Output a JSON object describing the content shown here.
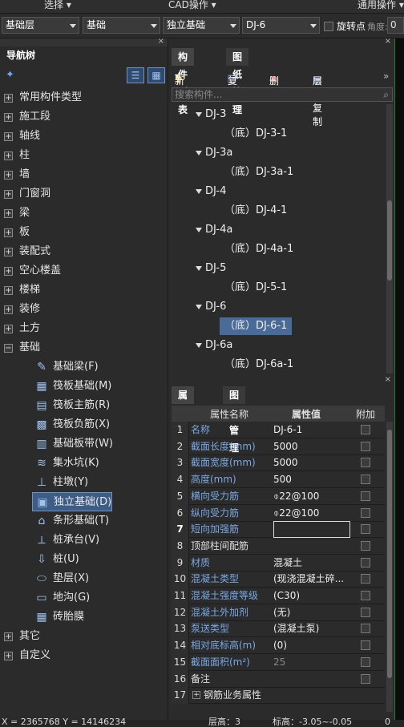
{
  "menu": {
    "select": "选择",
    "cad": "CAD操作",
    "general": "通用操作"
  },
  "toolbar": {
    "floor": "基础层",
    "category": "基础",
    "type": "独立基础",
    "component": "DJ-6",
    "rotate_label": "旋转点",
    "angle_label": "角度:",
    "angle_value": "0"
  },
  "nav": {
    "title": "导航树",
    "items": [
      "常用构件类型",
      "施工段",
      "轴线",
      "柱",
      "墙",
      "门窗洞",
      "梁",
      "板",
      "装配式",
      "空心楼盖",
      "楼梯",
      "装修",
      "土方",
      "基础"
    ],
    "sub_items": [
      "基础梁(F)",
      "筏板基础(M)",
      "筏板主筋(R)",
      "筏板负筋(X)",
      "基础板带(W)",
      "集水坑(K)",
      "柱墩(Y)",
      "独立基础(D)",
      "条形基础(T)",
      "桩承台(V)",
      "桩(U)",
      "垫层(X)",
      "地沟(G)",
      "砖胎膜"
    ],
    "bottom_items": [
      "其它",
      "自定义"
    ]
  },
  "comp_panel": {
    "tab_list": "构件列表",
    "tab_drawings": "图纸管理",
    "new": "新建",
    "copy": "复制",
    "delete": "删除",
    "floor_copy": "层间复制",
    "search_placeholder": "搜索构件...",
    "items": [
      {
        "label": "DJ-3",
        "level": 0
      },
      {
        "label": "（底）DJ-3-1",
        "level": 1
      },
      {
        "label": "DJ-3a",
        "level": 0
      },
      {
        "label": "（底）DJ-3a-1",
        "level": 1
      },
      {
        "label": "DJ-4",
        "level": 0
      },
      {
        "label": "（底）DJ-4-1",
        "level": 1
      },
      {
        "label": "DJ-4a",
        "level": 0
      },
      {
        "label": "（底）DJ-4a-1",
        "level": 1
      },
      {
        "label": "DJ-5",
        "level": 0
      },
      {
        "label": "（底）DJ-5-1",
        "level": 1
      },
      {
        "label": "DJ-6",
        "level": 0
      },
      {
        "label": "（底）DJ-6-1",
        "level": 1,
        "selected": true
      },
      {
        "label": "DJ-6a",
        "level": 0
      },
      {
        "label": "（底）DJ-6a-1",
        "level": 1
      }
    ]
  },
  "prop_panel": {
    "tab_props": "属性列表",
    "tab_layers": "图层管理",
    "col_name": "属性名称",
    "col_value": "属性值",
    "col_attach": "附加",
    "rows": [
      {
        "n": "1",
        "k": "名称",
        "v": "DJ-6-1",
        "blue": true
      },
      {
        "n": "2",
        "k": "截面长度(mm)",
        "v": "5000",
        "blue": true
      },
      {
        "n": "3",
        "k": "截面宽度(mm)",
        "v": "5000",
        "blue": true
      },
      {
        "n": "4",
        "k": "高度(mm)",
        "v": "500",
        "blue": true
      },
      {
        "n": "5",
        "k": "横向受力筋",
        "v": "⌽22@100",
        "blue": true
      },
      {
        "n": "6",
        "k": "纵向受力筋",
        "v": "⌽22@100",
        "blue": true
      },
      {
        "n": "7",
        "k": "短向加强筋",
        "v": "",
        "blue": true,
        "editing": true
      },
      {
        "n": "8",
        "k": "顶部柱间配筋",
        "v": "",
        "blue": false
      },
      {
        "n": "9",
        "k": "材质",
        "v": "混凝土",
        "blue": true
      },
      {
        "n": "10",
        "k": "混凝土类型",
        "v": "(现浇混凝土碎...",
        "blue": true
      },
      {
        "n": "11",
        "k": "混凝土强度等级",
        "v": "(C30)",
        "blue": true
      },
      {
        "n": "12",
        "k": "混凝土外加剂",
        "v": "(无)",
        "blue": true
      },
      {
        "n": "13",
        "k": "泵送类型",
        "v": "(混凝土泵)",
        "blue": true
      },
      {
        "n": "14",
        "k": "相对底标高(m)",
        "v": "(0)",
        "blue": true
      },
      {
        "n": "15",
        "k": "截面面积(m²)",
        "v": "25",
        "blue": true,
        "dim": true
      },
      {
        "n": "16",
        "k": "备注",
        "v": "",
        "blue": false
      },
      {
        "n": "17",
        "k": "钢筋业务属性",
        "v": "",
        "blue": false,
        "expand": true
      }
    ]
  },
  "status": {
    "coords": "X = 2365768 Y = 14146234",
    "floor": "层高：3",
    "elevation": "标高：-3.05~-0.05",
    "count": "0"
  },
  "colors": {
    "selection": "#3d5d85",
    "link_blue": "#7aa8e4",
    "ruler_green": "#1e7d1e"
  }
}
